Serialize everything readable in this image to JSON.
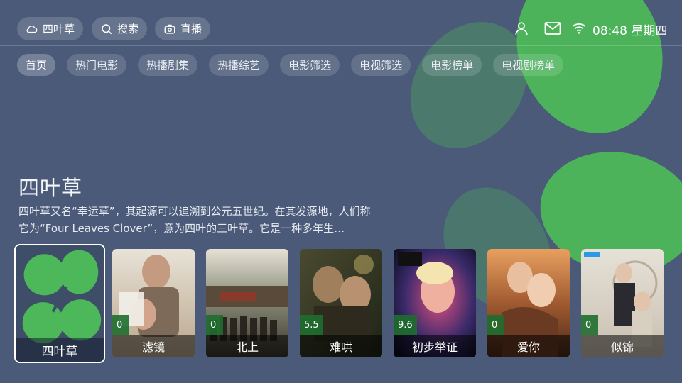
{
  "header": {
    "site_label": "四叶草",
    "search_label": "搜索",
    "live_label": "直播",
    "time": "08:48",
    "weekday": "星期四"
  },
  "icons": {
    "site": "cloud-icon",
    "search": "search-icon",
    "live": "camera-icon",
    "user": "user-icon",
    "mail": "mail-icon",
    "wifi": "wifi-icon"
  },
  "nav": [
    "首页",
    "热门电影",
    "热播剧集",
    "热播综艺",
    "电影筛选",
    "电视筛选",
    "电影榜单",
    "电视剧榜单"
  ],
  "hero": {
    "title": "四叶草",
    "description": "四叶草又名“幸运草”，其起源可以追溯到公元五世纪。在其发源地，人们称它为“Four Leaves Clover”，意为四叶的三叶草。它是一种多年生…"
  },
  "featured_card": {
    "label": "四叶草"
  },
  "cards": [
    {
      "title": "滤镜",
      "score": "0"
    },
    {
      "title": "北上",
      "score": "0"
    },
    {
      "title": "难哄",
      "score": "5.5"
    },
    {
      "title": "初步举证",
      "score": "9.6"
    },
    {
      "title": "爱你",
      "score": "0"
    },
    {
      "title": "似锦",
      "score": "0"
    }
  ],
  "colors": {
    "background": "#4a5a78",
    "clover": "#4cb85a",
    "score_badge": "#1e6e2d"
  }
}
